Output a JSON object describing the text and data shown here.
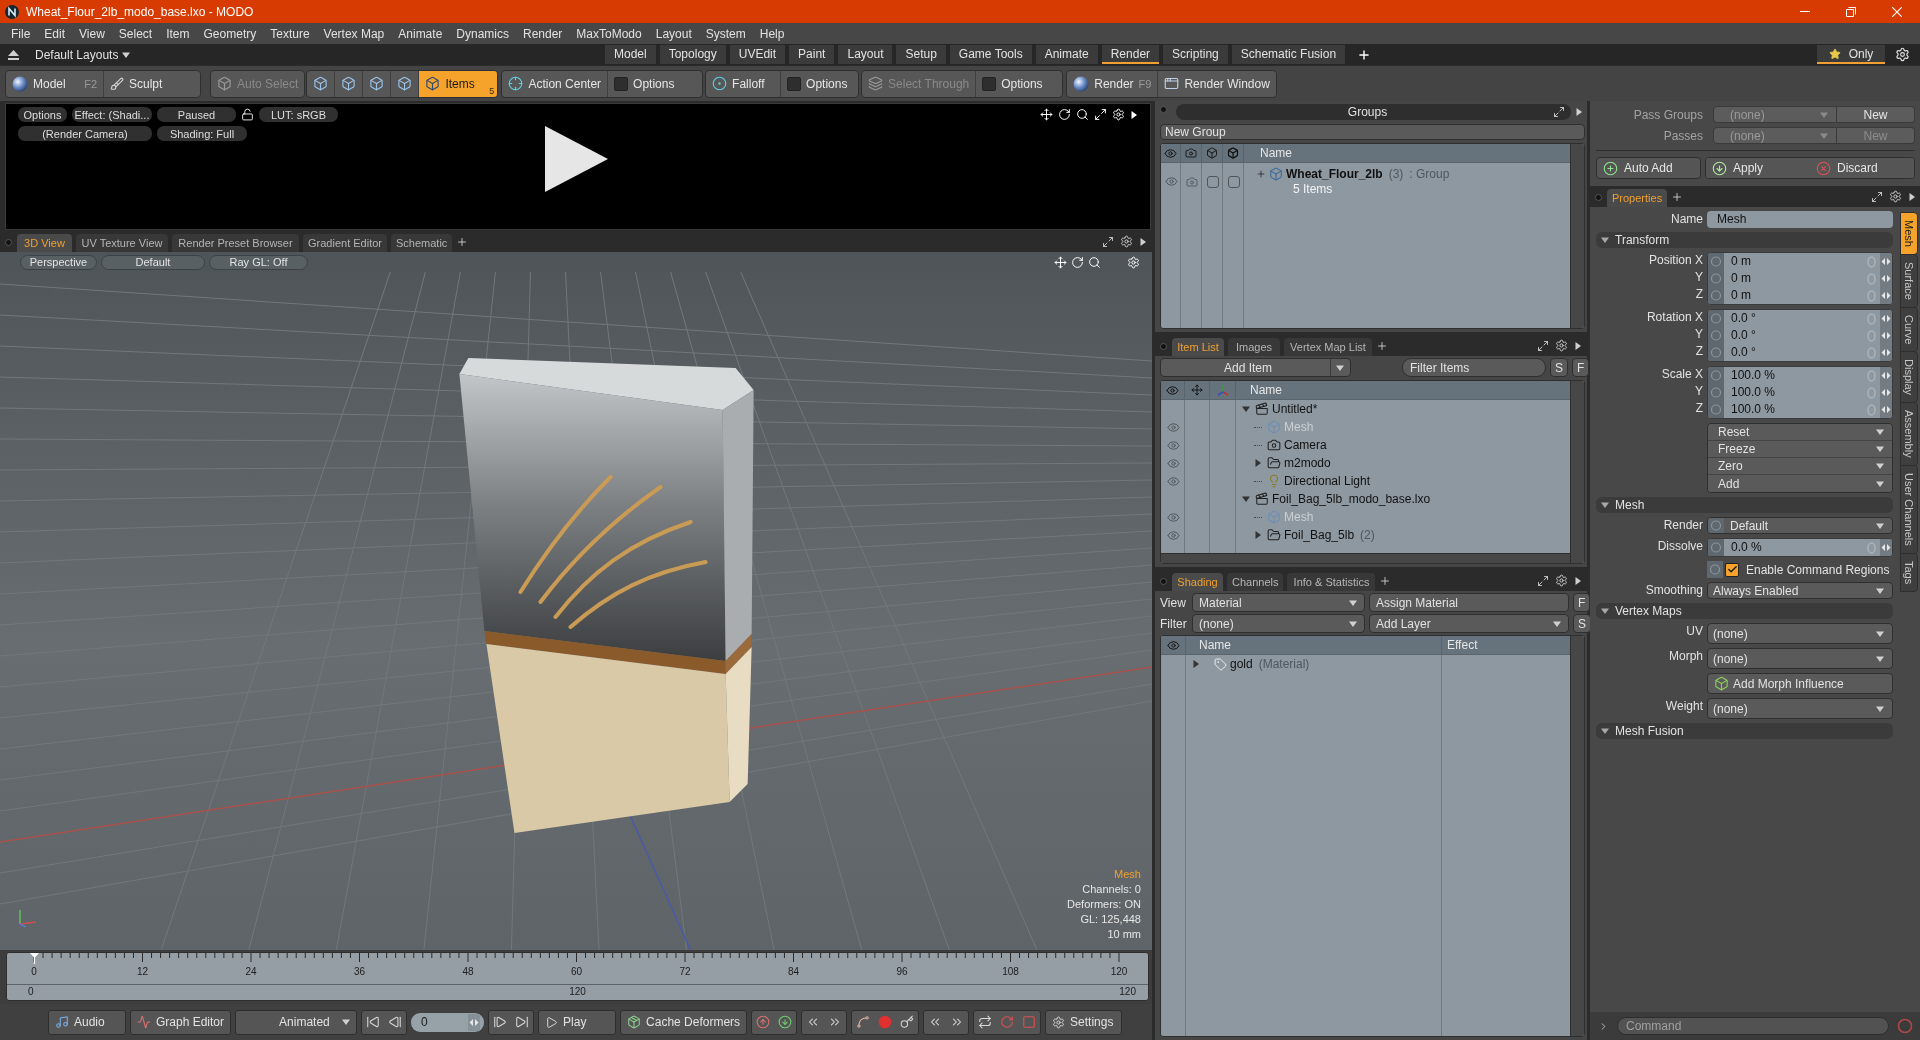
{
  "window": {
    "title": "Wheat_Flour_2lb_modo_base.lxo - MODO"
  },
  "menu": [
    "File",
    "Edit",
    "View",
    "Select",
    "Item",
    "Geometry",
    "Texture",
    "Vertex Map",
    "Animate",
    "Dynamics",
    "Render",
    "MaxToModo",
    "Layout",
    "System",
    "Help"
  ],
  "layout_bar": {
    "layout_menu": "Default Layouts",
    "tabs": [
      {
        "label": "Model",
        "selected": false
      },
      {
        "label": "Topology",
        "selected": false
      },
      {
        "label": "UVEdit",
        "selected": false
      },
      {
        "label": "Paint",
        "selected": false
      },
      {
        "label": "Layout",
        "selected": false
      },
      {
        "label": "Setup",
        "selected": false
      },
      {
        "label": "Game Tools",
        "selected": false
      },
      {
        "label": "Animate",
        "selected": false
      },
      {
        "label": "Render",
        "selected": true
      },
      {
        "label": "Scripting",
        "selected": false
      },
      {
        "label": "Schematic Fusion",
        "selected": false
      }
    ],
    "only": {
      "label": "Only",
      "on": true
    }
  },
  "toolbar": [
    [
      {
        "kind": "button",
        "label": "Model",
        "shortcut": "F2",
        "disabled": false
      },
      {
        "kind": "button",
        "label": "Sculpt",
        "disabled": false
      }
    ],
    [
      {
        "kind": "button",
        "label": "Auto Select",
        "disabled": true
      }
    ],
    [
      {
        "kind": "mode",
        "selected": false
      },
      {
        "kind": "mode",
        "selected": false
      },
      {
        "kind": "mode",
        "selected": false
      },
      {
        "kind": "mode",
        "selected": false
      },
      {
        "kind": "mode",
        "label": "Items",
        "count": "5",
        "selected": true
      }
    ],
    [
      {
        "kind": "button",
        "label": "Action Center",
        "disabled": false
      },
      {
        "kind": "check",
        "label": "Options",
        "checked": false
      }
    ],
    [
      {
        "kind": "button",
        "label": "Falloff",
        "disabled": false
      },
      {
        "kind": "check",
        "label": "Options",
        "checked": false
      }
    ],
    [
      {
        "kind": "button",
        "label": "Select Through",
        "disabled": true
      },
      {
        "kind": "check",
        "label": "Options",
        "checked": false
      }
    ],
    [
      {
        "kind": "button",
        "label": "Render",
        "shortcut": "F9",
        "disabled": false
      },
      {
        "kind": "button",
        "label": "Render Window",
        "disabled": false
      }
    ]
  ],
  "render_preview": {
    "controls": [
      {
        "kind": "button",
        "label": "Options"
      },
      {
        "kind": "button",
        "label": "Effect: (Shadi..."
      },
      {
        "kind": "button",
        "label": "Paused"
      },
      {
        "kind": "lock",
        "locked": false
      },
      {
        "kind": "button",
        "label": "LUT: sRGB"
      }
    ],
    "camera": "(Render Camera)",
    "shading": "Shading: Full"
  },
  "viewport": {
    "tabs": [
      {
        "label": "3D View",
        "selected": true
      },
      {
        "label": "UV Texture View",
        "selected": false
      },
      {
        "label": "Render Preset Browser",
        "selected": false
      },
      {
        "label": "Gradient Editor",
        "selected": false
      },
      {
        "label": "Schematic",
        "selected": false
      }
    ],
    "buttons": [
      "Perspective",
      "Default",
      "Ray GL: Off"
    ],
    "info": {
      "title": "Mesh",
      "lines": [
        "Channels: 0",
        "Deformers: ON",
        "GL: 125,448",
        "10 mm"
      ]
    }
  },
  "timeline": {
    "ticks": [
      "0",
      "12",
      "24",
      "36",
      "48",
      "60",
      "72",
      "84",
      "96",
      "108",
      "120"
    ],
    "range_labels": [
      "0",
      "120",
      "120"
    ],
    "level": 0
  },
  "bottom_bar": {
    "audio": "Audio",
    "graph_editor": "Graph Editor",
    "mode": "Animated",
    "frame": "0",
    "play": "Play",
    "cache": "Cache Deformers",
    "settings": "Settings"
  },
  "groups": {
    "title": "Groups",
    "new_group": "New Group",
    "column": "Name",
    "rows": [
      {
        "name": "Wheat_Flour_2lb",
        "count": "(3)",
        "type": ": Group",
        "detail": "5 Items"
      }
    ]
  },
  "item_list": {
    "tabs": [
      {
        "label": "Item List",
        "selected": true
      },
      {
        "label": "Images",
        "selected": false
      },
      {
        "label": "Vertex Map List",
        "selected": false
      }
    ],
    "add_item": "Add Item",
    "filter": {
      "placeholder": "Filter Items"
    },
    "buttons": [
      "S",
      "F"
    ],
    "column": "Name",
    "tree": [
      {
        "kind": "scene",
        "name": "Untitled*",
        "greyed": false,
        "expanded": true,
        "children": [
          {
            "kind": "mesh",
            "name": "Mesh",
            "greyed": true
          },
          {
            "kind": "camera",
            "name": "Camera",
            "greyed": false
          },
          {
            "kind": "group",
            "name": "m2modo",
            "greyed": false,
            "expanded": false
          },
          {
            "kind": "light",
            "name": "Directional Light",
            "greyed": false
          }
        ]
      },
      {
        "kind": "scene",
        "name": "Foil_Bag_5lb_modo_base.lxo",
        "greyed": false,
        "expanded": true,
        "children": [
          {
            "kind": "mesh",
            "name": "Mesh",
            "greyed": true
          },
          {
            "kind": "group",
            "name": "Foil_Bag_5lb",
            "count": "(2)",
            "greyed": false,
            "expanded": false
          }
        ]
      }
    ]
  },
  "shading": {
    "tabs": [
      {
        "label": "Shading",
        "selected": true
      },
      {
        "label": "Channels",
        "selected": false
      },
      {
        "label": "Info & Statistics",
        "selected": false
      }
    ],
    "view": {
      "label": "View",
      "value": "Material"
    },
    "assign": "Assign Material",
    "filter": {
      "label": "Filter",
      "value": "(none)"
    },
    "add_layer": "Add Layer",
    "buttons": [
      "F",
      "S"
    ],
    "columns": [
      "Name",
      "Effect"
    ],
    "rows": [
      {
        "name": "gold",
        "type": "(Material)",
        "expanded": false
      }
    ]
  },
  "passes": {
    "rows": [
      {
        "label": "Pass Groups",
        "value": "(none)",
        "button": "New",
        "disabled": false
      },
      {
        "label": "Passes",
        "value": "(none)",
        "button": "New",
        "disabled": true
      }
    ],
    "actions": [
      "Auto Add",
      "Apply",
      "Discard"
    ]
  },
  "properties": {
    "tabs": [
      {
        "label": "Properties",
        "selected": true
      }
    ],
    "name": {
      "label": "Name",
      "value": "Mesh"
    },
    "sections": [
      {
        "title": "Transform",
        "expanded": true,
        "rows": [
          {
            "kind": "vector",
            "fields": [
              {
                "label": "Position X",
                "value": "0 m"
              },
              {
                "label": "Y",
                "value": "0 m"
              },
              {
                "label": "Z",
                "value": "0 m"
              }
            ]
          },
          {
            "kind": "vector",
            "fields": [
              {
                "label": "Rotation X",
                "value": "0.0 °"
              },
              {
                "label": "Y",
                "value": "0.0 °"
              },
              {
                "label": "Z",
                "value": "0.0 °"
              }
            ]
          },
          {
            "kind": "vector",
            "fields": [
              {
                "label": "Scale X",
                "value": "100.0 %"
              },
              {
                "label": "Y",
                "value": "100.0 %"
              },
              {
                "label": "Z",
                "value": "100.0 %"
              }
            ]
          },
          {
            "kind": "menus",
            "items": [
              "Reset",
              "Freeze",
              "Zero",
              "Add"
            ]
          }
        ]
      },
      {
        "title": "Mesh",
        "expanded": true,
        "rows": [
          {
            "kind": "dropdown",
            "label": "Render",
            "value": "Default",
            "keyable": true
          },
          {
            "kind": "vector",
            "fields": [
              {
                "label": "Dissolve",
                "value": "0.0 %"
              }
            ]
          },
          {
            "kind": "check",
            "label": "Enable Command Regions",
            "checked": true
          },
          {
            "kind": "dropdown",
            "label": "Smoothing",
            "value": "Always Enabled",
            "keyable": false
          }
        ]
      },
      {
        "title": "Vertex Maps",
        "expanded": true,
        "rows": [
          {
            "kind": "dropdown",
            "label": "UV",
            "value": "(none)",
            "keyable": false
          },
          {
            "kind": "dropdown",
            "label": "Morph",
            "value": "(none)",
            "keyable": false
          },
          {
            "kind": "action",
            "label": "Add Morph Influence"
          },
          {
            "kind": "dropdown",
            "label": "Weight",
            "value": "(none)",
            "keyable": false
          }
        ]
      },
      {
        "title": "Mesh Fusion",
        "expanded": true
      }
    ],
    "side_tabs": [
      {
        "label": "Mesh",
        "selected": true
      },
      {
        "label": "Surface",
        "selected": false
      },
      {
        "label": "Curve",
        "selected": false
      },
      {
        "label": "Display",
        "selected": false
      },
      {
        "label": "Assembly",
        "selected": false
      },
      {
        "label": "User Channels",
        "selected": false
      },
      {
        "label": "Tags",
        "selected": false
      }
    ]
  },
  "command": {
    "placeholder": "Command"
  }
}
